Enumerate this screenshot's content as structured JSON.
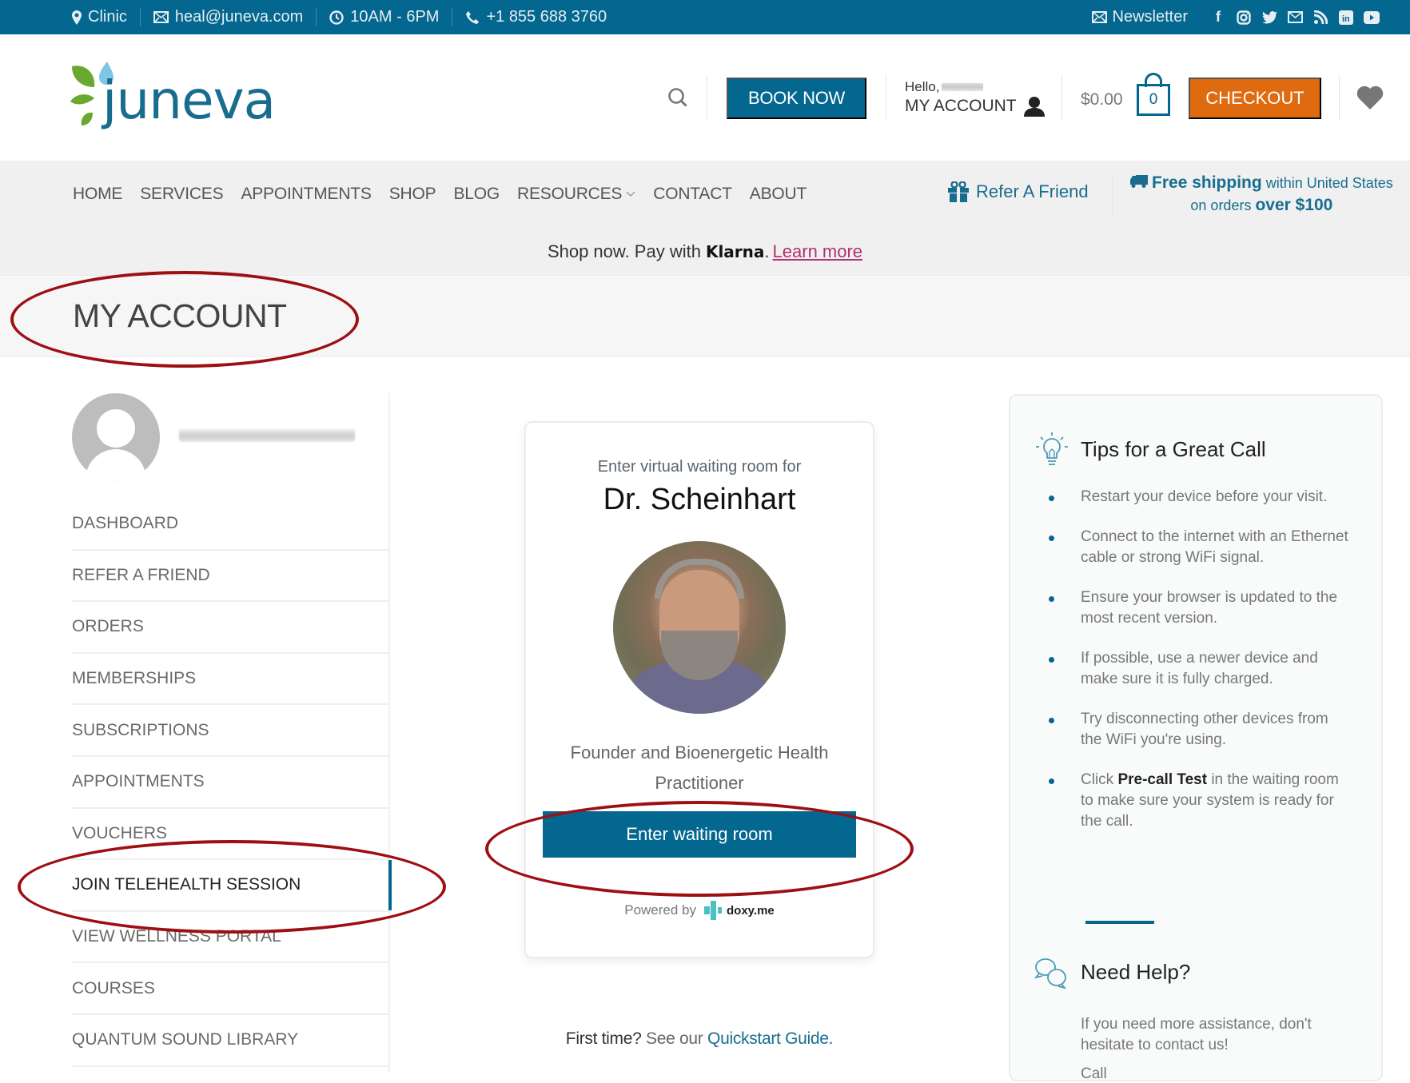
{
  "topbar": {
    "clinic": "Clinic",
    "email": "heal@juneva.com",
    "hours": "10AM - 6PM",
    "phone": "+1 855 688 3760",
    "newsletter": "Newsletter",
    "social_icons": [
      "facebook-icon",
      "instagram-icon",
      "twitter-icon",
      "email-icon",
      "rss-icon",
      "linkedin-icon",
      "youtube-icon"
    ]
  },
  "header": {
    "logo_text": "juneva",
    "book_now": "BOOK NOW",
    "hello": "Hello,",
    "my_account": "MY ACCOUNT",
    "cart_total": "$0.00",
    "cart_count": "0",
    "checkout": "CHECKOUT"
  },
  "nav": {
    "items": [
      "HOME",
      "SERVICES",
      "APPOINTMENTS",
      "SHOP",
      "BLOG",
      "RESOURCES",
      "CONTACT",
      "ABOUT"
    ],
    "refer": "Refer A Friend",
    "ship_bold": "Free shipping",
    "ship_rest": " within United States",
    "ship_line2": "on orders ",
    "ship_line2_bold": "over $100"
  },
  "klarna": {
    "text": "Shop now. Pay with",
    "brand": "Klarna",
    "dot": ".",
    "link": "Learn more"
  },
  "page": {
    "title": "MY ACCOUNT"
  },
  "sidebar": {
    "items": [
      {
        "label": "DASHBOARD"
      },
      {
        "label": "REFER A FRIEND"
      },
      {
        "label": "ORDERS"
      },
      {
        "label": "MEMBERSHIPS"
      },
      {
        "label": "SUBSCRIPTIONS"
      },
      {
        "label": "APPOINTMENTS"
      },
      {
        "label": "VOUCHERS"
      },
      {
        "label": "JOIN TELEHEALTH SESSION",
        "active": true
      },
      {
        "label": "VIEW WELLNESS PORTAL"
      },
      {
        "label": "COURSES"
      },
      {
        "label": "QUANTUM SOUND LIBRARY"
      }
    ]
  },
  "card": {
    "enter_for": "Enter virtual waiting room for",
    "doctor": "Dr. Scheinhart",
    "role": "Founder and Bioenergetic Health Practitioner",
    "button": "Enter waiting room",
    "powered_by": "Powered by",
    "brand": "doxy.me"
  },
  "first_time": {
    "bold": "First time?",
    "text": " See our ",
    "link": "Quickstart Guide."
  },
  "tips": {
    "title": "Tips for a Great Call",
    "items": [
      "Restart your device before your visit.",
      "Connect to the internet with an Ethernet cable or strong WiFi signal.",
      "Ensure your browser is updated to the most recent version.",
      "If possible, use a newer device and make sure it is fully charged.",
      "Try disconnecting other devices from the WiFi you're using."
    ],
    "last_pre": "Click ",
    "last_bold": "Pre-call Test",
    "last_post": " in the waiting room to make sure your system is ready for the call.",
    "help_title": "Need Help?",
    "help_text": "If you need more assistance, don't hesitate to contact us!",
    "call": "Call"
  },
  "colors": {
    "brand": "#03678f",
    "checkout": "#e06a10",
    "annotation": "#9e0f14",
    "klarna_link": "#b0326f"
  }
}
